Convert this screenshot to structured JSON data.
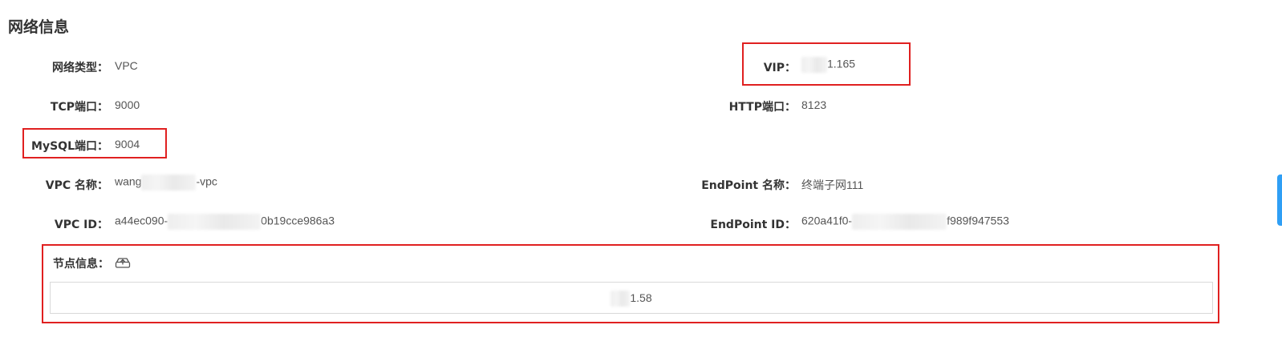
{
  "section": {
    "title": "网络信息"
  },
  "fields": {
    "network_type": {
      "label": "网络类型：",
      "value": "VPC"
    },
    "vip": {
      "label": "VIP：",
      "value_suffix": "1.165"
    },
    "tcp_port": {
      "label": "TCP端口：",
      "value": "9000"
    },
    "http_port": {
      "label": "HTTP端口：",
      "value": "8123"
    },
    "mysql_port": {
      "label": "MySQL端口：",
      "value": "9004"
    },
    "vpc_name": {
      "label": "VPC 名称：",
      "value_prefix": "wang",
      "value_suffix": "-vpc"
    },
    "endpoint_name": {
      "label": "EndPoint 名称：",
      "value": "终端子网111"
    },
    "vpc_id": {
      "label": "VPC ID：",
      "value_prefix": "a44ec090-",
      "value_suffix": "0b19cce986a3"
    },
    "endpoint_id": {
      "label": "EndPoint ID：",
      "value_prefix": "620a41f0-",
      "value_suffix": "f989f947553"
    }
  },
  "nodes": {
    "label": "节点信息：",
    "icon": "cloud-upload-icon",
    "items": [
      {
        "value_suffix": "1.58"
      }
    ]
  },
  "colors": {
    "highlight": "#e02020",
    "side_tab": "#2f9ff5"
  }
}
